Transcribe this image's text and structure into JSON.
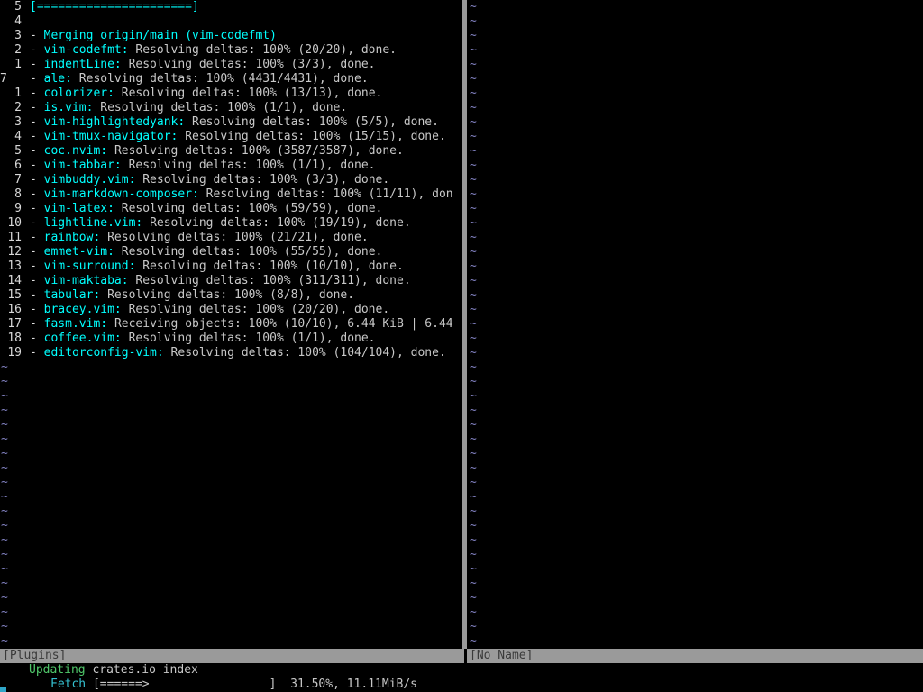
{
  "left_pane": {
    "top_line": {
      "num": "5",
      "text": "[======================]"
    },
    "blank_line": {
      "num": "4"
    },
    "merge_line": {
      "num": "3",
      "sep": "-",
      "text": "Merging origin/main (vim-codefmt)"
    },
    "plugins": [
      {
        "num": "2",
        "name": "vim-codefmt:",
        "msg": "Resolving deltas: 100% (20/20), done."
      },
      {
        "num": "1",
        "name": "indentLine:",
        "msg": "Resolving deltas: 100% (3/3), done."
      },
      {
        "num": "7",
        "name": "ale:",
        "msg": "Resolving deltas: 100% (4431/4431), done.",
        "current": true
      },
      {
        "num": "1",
        "name": "colorizer:",
        "msg": "Resolving deltas: 100% (13/13), done."
      },
      {
        "num": "2",
        "name": "is.vim:",
        "msg": "Resolving deltas: 100% (1/1), done."
      },
      {
        "num": "3",
        "name": "vim-highlightedyank:",
        "msg": "Resolving deltas: 100% (5/5), done."
      },
      {
        "num": "4",
        "name": "vim-tmux-navigator:",
        "msg": "Resolving deltas: 100% (15/15), done."
      },
      {
        "num": "5",
        "name": "coc.nvim:",
        "msg": "Resolving deltas: 100% (3587/3587), done."
      },
      {
        "num": "6",
        "name": "vim-tabbar:",
        "msg": "Resolving deltas: 100% (1/1), done."
      },
      {
        "num": "7",
        "name": "vimbuddy.vim:",
        "msg": "Resolving deltas: 100% (3/3), done."
      },
      {
        "num": "8",
        "name": "vim-markdown-composer:",
        "msg": "Resolving deltas: 100% (11/11), don"
      },
      {
        "num": "9",
        "name": "vim-latex:",
        "msg": "Resolving deltas: 100% (59/59), done."
      },
      {
        "num": "10",
        "name": "lightline.vim:",
        "msg": "Resolving deltas: 100% (19/19), done."
      },
      {
        "num": "11",
        "name": "rainbow:",
        "msg": "Resolving deltas: 100% (21/21), done."
      },
      {
        "num": "12",
        "name": "emmet-vim:",
        "msg": "Resolving deltas: 100% (55/55), done."
      },
      {
        "num": "13",
        "name": "vim-surround:",
        "msg": "Resolving deltas: 100% (10/10), done."
      },
      {
        "num": "14",
        "name": "vim-maktaba:",
        "msg": "Resolving deltas: 100% (311/311), done."
      },
      {
        "num": "15",
        "name": "tabular:",
        "msg": "Resolving deltas: 100% (8/8), done."
      },
      {
        "num": "16",
        "name": "bracey.vim:",
        "msg": "Resolving deltas: 100% (20/20), done."
      },
      {
        "num": "17",
        "name": "fasm.vim:",
        "msg": "Receiving objects: 100% (10/10), 6.44 KiB | 6.44"
      },
      {
        "num": "18",
        "name": "coffee.vim:",
        "msg": "Resolving deltas: 100% (1/1), done."
      },
      {
        "num": "19",
        "name": "editorconfig-vim:",
        "msg": "Resolving deltas: 100% (104/104), done."
      }
    ],
    "sep_char": "-",
    "empty_line_marker": "~"
  },
  "right_pane": {
    "empty_line_marker": "~"
  },
  "status_bar": {
    "left": "[Plugins]",
    "right": "[No Name]"
  },
  "command_area": {
    "line1": {
      "status": "Updating",
      "text": "crates.io index"
    },
    "line2": {
      "status": "Fetch",
      "text": "[======>                 ]  31.50%, 11.11MiB/s"
    }
  }
}
